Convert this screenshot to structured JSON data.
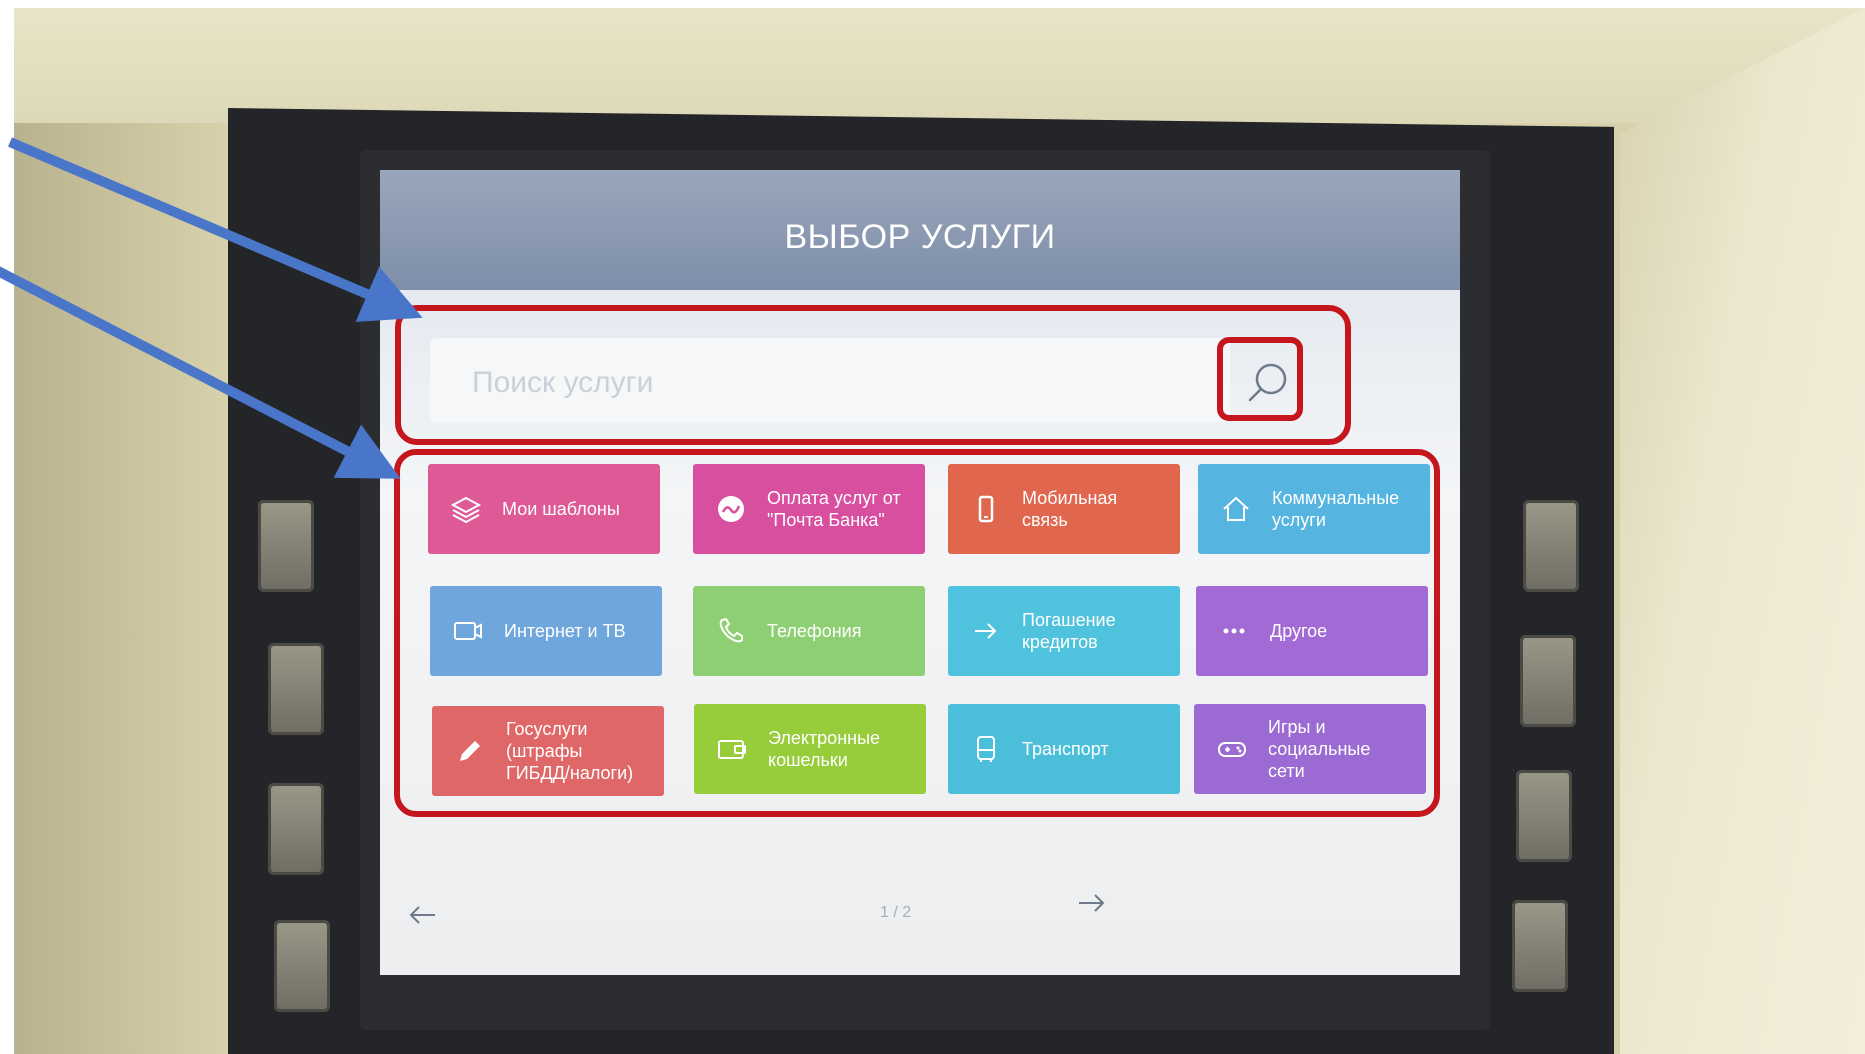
{
  "screen": {
    "title": "ВЫБОР УСЛУГИ",
    "search": {
      "placeholder": "Поиск услуги",
      "icon": "search-icon"
    },
    "tiles": [
      {
        "label": "Мои шаблоны",
        "icon": "layers-icon",
        "color": "#dd5a97"
      },
      {
        "label": "Оплата услуг от\n\"Почта Банка\"",
        "icon": "swirl-icon",
        "color": "#d94fa0"
      },
      {
        "label": "Мобильная\nсвязь",
        "icon": "phone-icon",
        "color": "#e0664d"
      },
      {
        "label": "Коммунальные\nуслуги",
        "icon": "home-icon",
        "color": "#56b4e0"
      },
      {
        "label": "Интернет и ТВ",
        "icon": "tv-icon",
        "color": "#6fa6dc"
      },
      {
        "label": "Телефония",
        "icon": "handset-icon",
        "color": "#8dcf72"
      },
      {
        "label": "Погашение\nкредитов",
        "icon": "arrow-right-icon",
        "color": "#4fc3de"
      },
      {
        "label": "Другое",
        "icon": "dots-icon",
        "color": "#a26ad5"
      },
      {
        "label": "Госуслуги\n(штрафы\nГИБДД/налоги)",
        "icon": "pen-icon",
        "color": "#e06767"
      },
      {
        "label": "Электронные\nкошельки",
        "icon": "wallet-icon",
        "color": "#97cc3a"
      },
      {
        "label": "Транспорт",
        "icon": "bus-icon",
        "color": "#4bbfd9"
      },
      {
        "label": "Игры и\nсоциальные\nсети",
        "icon": "gamepad-icon",
        "color": "#9b6bd3"
      }
    ],
    "pager": {
      "prev_icon": "arrow-left-icon",
      "next_icon": "arrow-right-icon",
      "page_text": "1 / 2"
    }
  },
  "annotation_color": "#c5161d",
  "arrow_color": "#4a76c9"
}
